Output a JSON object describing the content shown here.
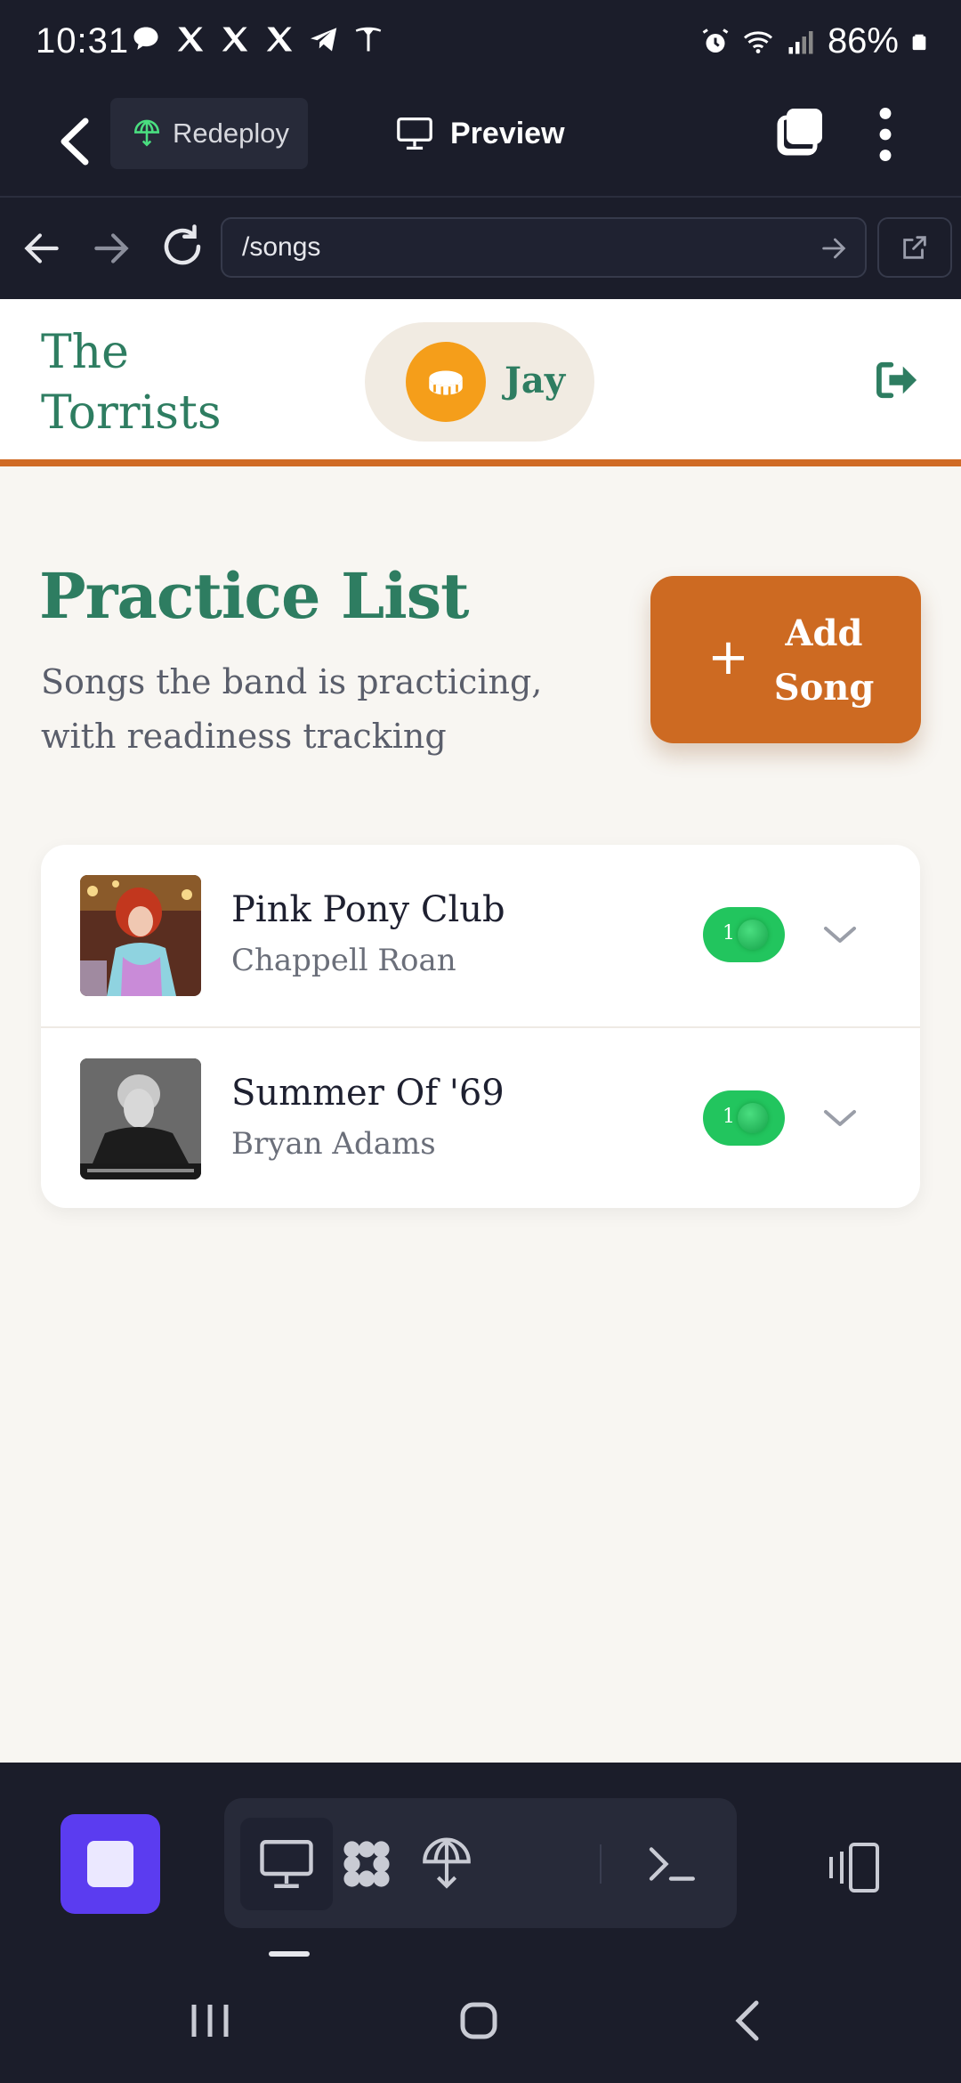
{
  "status_bar": {
    "time": "10:31",
    "battery": "86%",
    "left_icons": [
      "chat-icon",
      "x-icon",
      "x-icon",
      "x-icon",
      "telegram-icon",
      "tesla-icon"
    ],
    "right_icons": [
      "alarm-icon",
      "wifi-icon",
      "signal-icon",
      "battery-icon"
    ]
  },
  "app_header": {
    "redeploy_label": "Redeploy",
    "preview_label": "Preview"
  },
  "url_bar": {
    "url": "/songs"
  },
  "site": {
    "title": "The Torrists",
    "user_name": "Jay",
    "accent": "#2e7d61",
    "orange": "#cd6a22"
  },
  "page": {
    "title": "Practice List",
    "subtitle": "Songs the band is practicing, with readiness tracking",
    "add_button_plus": "+",
    "add_button_label": "Add Song"
  },
  "songs": [
    {
      "title": "Pink Pony Club",
      "artist": "Chappell Roan",
      "ready_count": "1",
      "status_color": "#22c55e"
    },
    {
      "title": "Summer Of '69",
      "artist": "Bryan Adams",
      "ready_count": "1",
      "status_color": "#22c55e"
    }
  ],
  "bottom_toolbar": {
    "tools": [
      "monitor-icon",
      "grid-icon",
      "deploy-icon",
      "terminal-icon"
    ],
    "active_tool": "monitor-icon"
  }
}
